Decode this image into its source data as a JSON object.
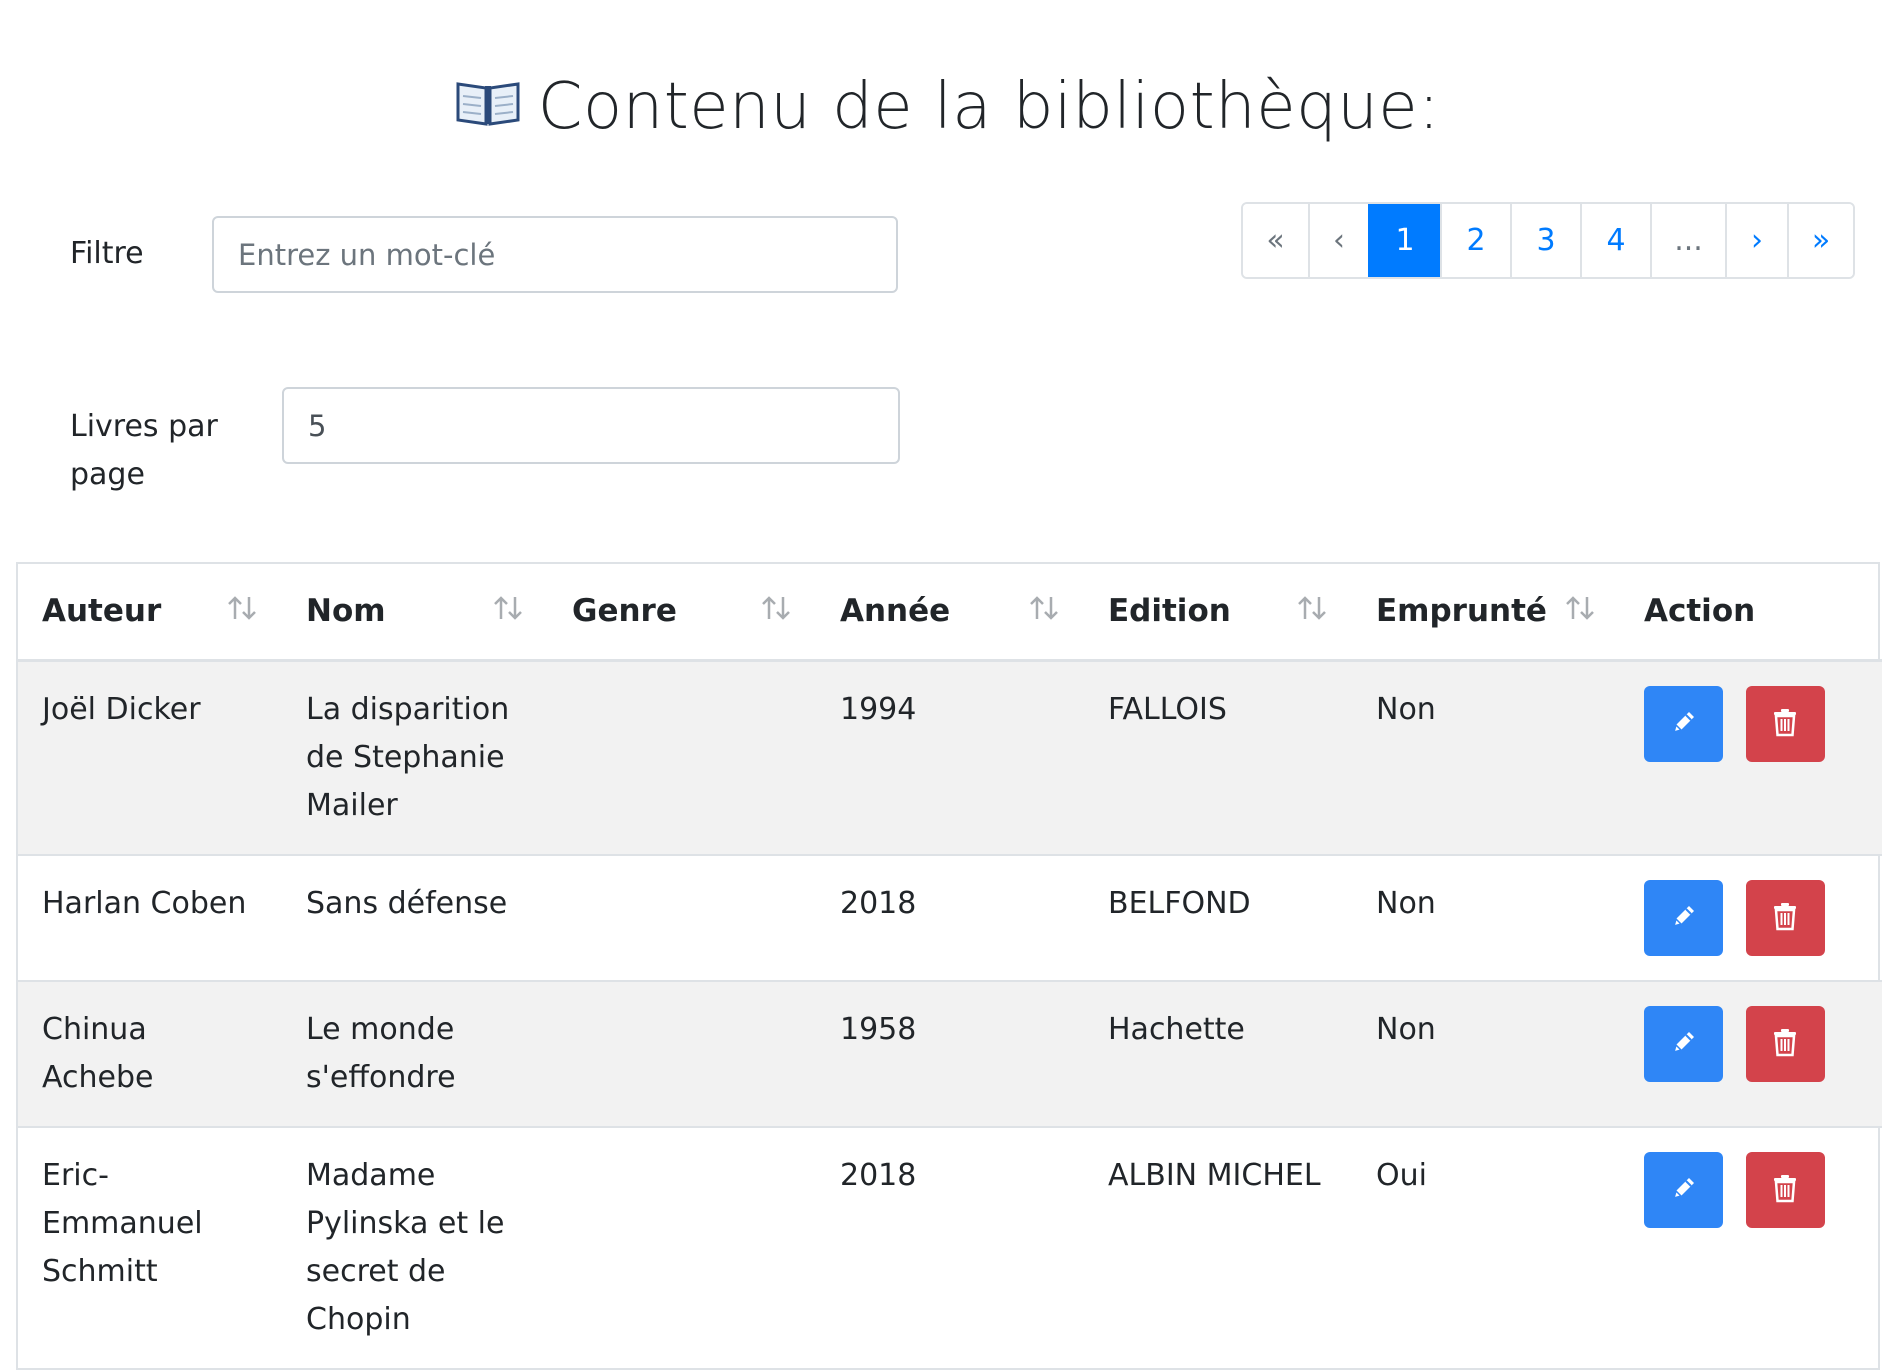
{
  "header": {
    "title": "Contenu de la bibliothèque:",
    "icon": "open-book-icon"
  },
  "filter": {
    "label": "Filtre",
    "placeholder": "Entrez un mot-clé",
    "value": ""
  },
  "per_page": {
    "label": "Livres par page",
    "value": "5"
  },
  "pagination": {
    "first": "«",
    "prev": "‹",
    "pages": [
      "1",
      "2",
      "3",
      "4"
    ],
    "ellipsis": "...",
    "next": "›",
    "last": "»",
    "active_page": "1"
  },
  "table": {
    "columns": [
      "Auteur",
      "Nom",
      "Genre",
      "Année",
      "Edition",
      "Emprunté",
      "Action"
    ],
    "rows": [
      {
        "auteur": "Joël Dicker",
        "nom": "La disparition de Stephanie Mailer",
        "genre": "",
        "annee": "1994",
        "edition": "FALLOIS",
        "emprunte": "Non"
      },
      {
        "auteur": "Harlan Coben",
        "nom": "Sans défense",
        "genre": "",
        "annee": "2018",
        "edition": "BELFOND",
        "emprunte": "Non"
      },
      {
        "auteur": "Chinua Achebe",
        "nom": "Le monde s'effondre",
        "genre": "",
        "annee": "1958",
        "edition": "Hachette",
        "emprunte": "Non"
      },
      {
        "auteur": "Eric-Emmanuel Schmitt",
        "nom": "Madame Pylinska et le secret de Chopin",
        "genre": "",
        "annee": "2018",
        "edition": "ALBIN MICHEL",
        "emprunte": "Oui"
      }
    ]
  },
  "colors": {
    "primary": "#007bff",
    "danger": "#d3434b",
    "stripe": "#f2f2f2"
  }
}
